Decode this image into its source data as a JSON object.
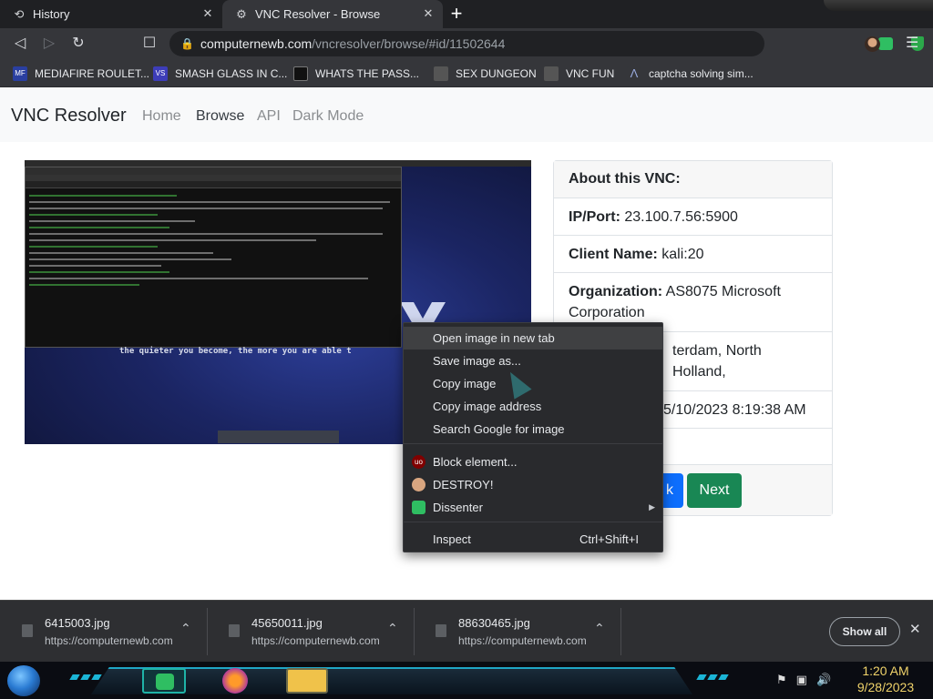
{
  "browser": {
    "tabs": [
      {
        "label": "History",
        "icon": "history-icon"
      },
      {
        "label": "VNC Resolver - Browse",
        "icon": "vnc-favicon"
      }
    ],
    "url_host": "computernewb.com",
    "url_path": "/vncresolver/browse/#id/11502644"
  },
  "bookmarks": [
    {
      "label": "MEDIAFIRE ROULET...",
      "icon_text": "MF"
    },
    {
      "label": "SMASH GLASS IN C...",
      "icon_text": "VS"
    },
    {
      "label": "WHATS THE PASS...",
      "icon_text": ""
    },
    {
      "label": "SEX DUNGEON",
      "icon_text": ""
    },
    {
      "label": "VNC FUN",
      "icon_text": ""
    },
    {
      "label": "captcha solving sim...",
      "icon_text": ""
    }
  ],
  "site": {
    "brand": "VNC Resolver",
    "nav": [
      "Home",
      "Browse",
      "API",
      "Dark Mode"
    ]
  },
  "vnc_screenshot": {
    "slogan": "the quieter you become, the more you are able t"
  },
  "card": {
    "header": "About this VNC:",
    "ip_label": "IP/Port:",
    "ip_value": "23.100.7.56:5900",
    "client_label": "Client Name:",
    "client_value": "kali:20",
    "org_label": "Organization:",
    "org_value": "AS8075 Microsoft Corporation",
    "location_partial": "terdam, North Holland,",
    "date_partial": "5/10/2023 8:19:38 AM",
    "back_partial": "k",
    "next_label": "Next"
  },
  "context_menu": {
    "items": [
      "Open image in new tab",
      "Save image as...",
      "Copy image",
      "Copy image address",
      "Search Google for image"
    ],
    "ext_items": [
      {
        "label": "Block element...",
        "icon_text": "uo",
        "color": "#800000"
      },
      {
        "label": "DESTROY!",
        "icon_text": "",
        "color": "#d9a680"
      },
      {
        "label": "Dissenter",
        "icon_text": "",
        "color": "#2fbe62"
      }
    ],
    "inspect": "Inspect",
    "inspect_shortcut": "Ctrl+Shift+I"
  },
  "downloads": {
    "items": [
      {
        "name": "6415003.jpg",
        "source": "https://computernewb.com"
      },
      {
        "name": "45650011.jpg",
        "source": "https://computernewb.com"
      },
      {
        "name": "88630465.jpg",
        "source": "https://computernewb.com"
      }
    ],
    "show_all": "Show all"
  },
  "taskbar": {
    "time": "1:20 AM",
    "date": "9/28/2023"
  }
}
